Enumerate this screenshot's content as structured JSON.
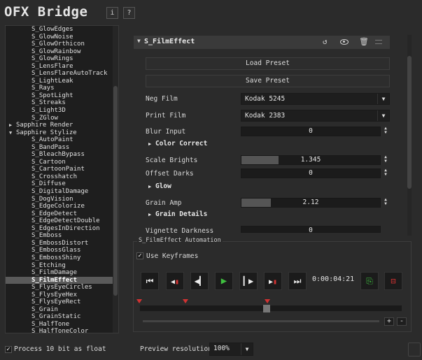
{
  "app": {
    "title": "OFX Bridge",
    "info_label": "i",
    "help_label": "?"
  },
  "tree": {
    "items": [
      {
        "label": "S_GlowEdges",
        "level": 1
      },
      {
        "label": "S_GlowNoise",
        "level": 1
      },
      {
        "label": "S_GlowOrthicon",
        "level": 1
      },
      {
        "label": "S_GlowRainbow",
        "level": 1
      },
      {
        "label": "S_GlowRings",
        "level": 1
      },
      {
        "label": "S_LensFlare",
        "level": 1
      },
      {
        "label": "S_LensFlareAutoTrack",
        "level": 1
      },
      {
        "label": "S_LightLeak",
        "level": 1
      },
      {
        "label": "S_Rays",
        "level": 1
      },
      {
        "label": "S_SpotLight",
        "level": 1
      },
      {
        "label": "S_Streaks",
        "level": 1
      },
      {
        "label": "S_Light3D",
        "level": 1
      },
      {
        "label": "S_ZGlow",
        "level": 1
      },
      {
        "label": "Sapphire Render",
        "level": 0,
        "expanded": false
      },
      {
        "label": "Sapphire Stylize",
        "level": 0,
        "expanded": true
      },
      {
        "label": "S_AutoPaint",
        "level": 1
      },
      {
        "label": "S_BandPass",
        "level": 1
      },
      {
        "label": "S_BleachBypass",
        "level": 1
      },
      {
        "label": "S_Cartoon",
        "level": 1
      },
      {
        "label": "S_CartoonPaint",
        "level": 1
      },
      {
        "label": "S_Crosshatch",
        "level": 1
      },
      {
        "label": "S_Diffuse",
        "level": 1
      },
      {
        "label": "S_DigitalDamage",
        "level": 1
      },
      {
        "label": "S_DogVision",
        "level": 1
      },
      {
        "label": "S_EdgeColorize",
        "level": 1
      },
      {
        "label": "S_EdgeDetect",
        "level": 1
      },
      {
        "label": "S_EdgeDetectDouble",
        "level": 1
      },
      {
        "label": "S_EdgesInDirection",
        "level": 1
      },
      {
        "label": "S_Emboss",
        "level": 1
      },
      {
        "label": "S_EmbossDistort",
        "level": 1
      },
      {
        "label": "S_EmbossGlass",
        "level": 1
      },
      {
        "label": "S_EmbossShiny",
        "level": 1
      },
      {
        "label": "S_Etching",
        "level": 1
      },
      {
        "label": "S_FilmDamage",
        "level": 1
      },
      {
        "label": "S_FilmEffect",
        "level": 1,
        "selected": true
      },
      {
        "label": "S_FlysEyeCircles",
        "level": 1
      },
      {
        "label": "S_FlysEyeHex",
        "level": 1
      },
      {
        "label": "S_FlysEyeRect",
        "level": 1
      },
      {
        "label": "S_Grain",
        "level": 1
      },
      {
        "label": "S_GrainStatic",
        "level": 1
      },
      {
        "label": "S_HalfTone",
        "level": 1
      },
      {
        "label": "S_HalfToneColor",
        "level": 1
      }
    ]
  },
  "effect": {
    "name": "S_FilmEffect",
    "header_icons": [
      "undo-icon",
      "eye-icon",
      "trash-icon",
      "menu-icon"
    ],
    "load_preset": "Load Preset",
    "save_preset": "Save Preset",
    "neg_film": {
      "label": "Neg Film",
      "value": "Kodak 5245"
    },
    "print_film": {
      "label": "Print Film",
      "value": "Kodak 2383"
    },
    "blur_input": {
      "label": "Blur Input",
      "value": "0"
    },
    "color_correct": "Color Correct",
    "scale_brights": {
      "label": "Scale Brights",
      "value": "1.345",
      "fill": 0.27
    },
    "offset_darks": {
      "label": "Offset Darks",
      "value": "0"
    },
    "glow": "Glow",
    "grain_amp": {
      "label": "Grain Amp",
      "value": "2.12",
      "fill": 0.21
    },
    "grain_details": "Grain Details",
    "vignette_darkness": {
      "label": "Vignette Darkness",
      "value": "0"
    }
  },
  "automation": {
    "title": "S_FilmEffect Automation",
    "use_keyframes": "Use Keyframes",
    "use_keyframes_checked": true,
    "timecode": "0:00:04:21",
    "plus": "+",
    "minus": "-"
  },
  "footer": {
    "process_float": "Process 10 bit as float",
    "process_float_checked": true,
    "preview_label": "Preview resolution",
    "preview_value": "100%"
  },
  "colors": {
    "keyframe": "#d23232",
    "play": "#3fbf3f"
  }
}
